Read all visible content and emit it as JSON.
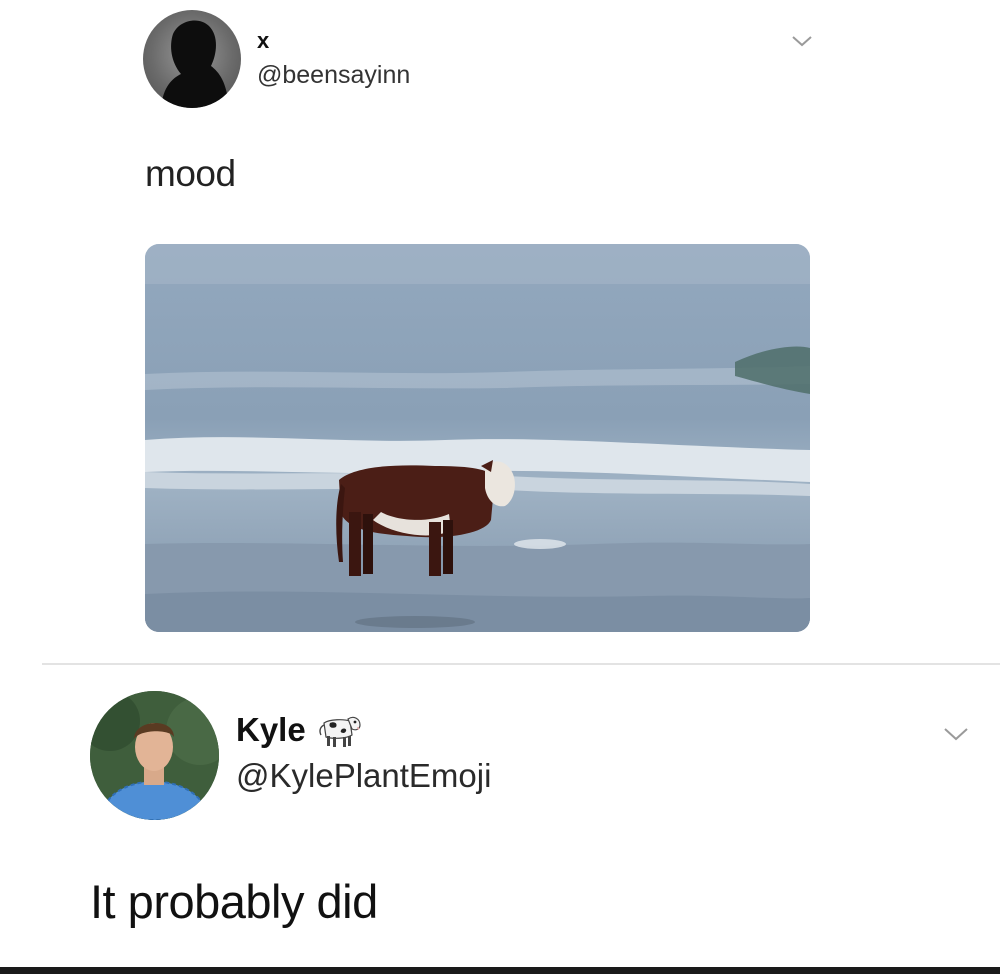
{
  "tweet_1": {
    "display_name": "x",
    "handle": "@beensayinn",
    "text": "mood",
    "media_icon": "cow-standing-in-ocean-photo",
    "menu_icon": "chevron-down-icon"
  },
  "tweet_2": {
    "display_name": "Kyle",
    "name_emoji_icon": "cow-emoji-icon",
    "handle": "@KylePlantEmoji",
    "text": "It probably did",
    "menu_icon": "chevron-down-icon"
  },
  "colors": {
    "background": "#ffffff",
    "text": "#111111",
    "divider": "#e3e3e3",
    "chevron": "#9a9a9a"
  }
}
